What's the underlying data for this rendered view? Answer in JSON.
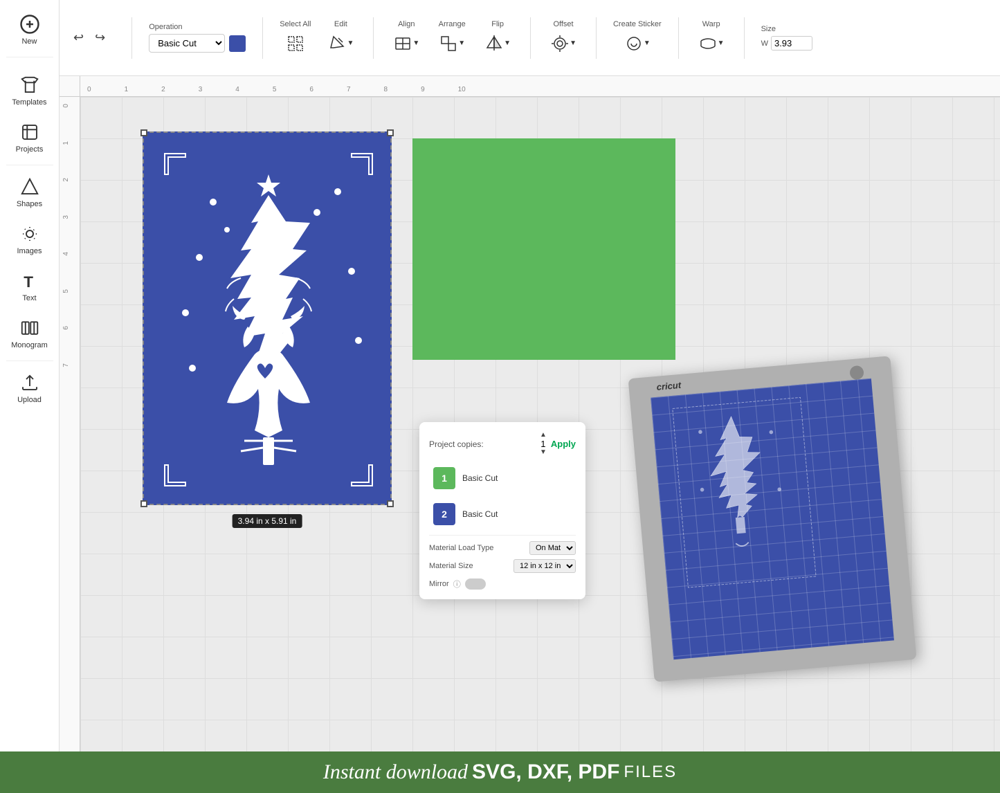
{
  "sidebar": {
    "items": [
      {
        "id": "new",
        "label": "New",
        "icon": "plus"
      },
      {
        "id": "templates",
        "label": "Templates",
        "icon": "tshirt"
      },
      {
        "id": "projects",
        "label": "Projects",
        "icon": "clipboard"
      },
      {
        "id": "shapes",
        "label": "Shapes",
        "icon": "triangle"
      },
      {
        "id": "images",
        "label": "Images",
        "icon": "image"
      },
      {
        "id": "text",
        "label": "Text",
        "icon": "T"
      },
      {
        "id": "monogram",
        "label": "Monogram",
        "icon": "monogram"
      },
      {
        "id": "upload",
        "label": "Upload",
        "icon": "upload"
      }
    ]
  },
  "toolbar": {
    "operation_label": "Operation",
    "operation_value": "Basic Cut",
    "select_all_label": "Select All",
    "edit_label": "Edit",
    "align_label": "Align",
    "arrange_label": "Arrange",
    "flip_label": "Flip",
    "offset_label": "Offset",
    "create_sticker_label": "Create Sticker",
    "warp_label": "Warp",
    "size_label": "Size",
    "size_w_label": "W",
    "size_w_value": "3.93"
  },
  "canvas": {
    "ruler_marks": [
      "0",
      "1",
      "2",
      "3",
      "4",
      "5",
      "6",
      "7",
      "8",
      "9",
      "10"
    ],
    "ruler_marks_v": [
      "0",
      "1",
      "2",
      "3",
      "4",
      "5",
      "6",
      "7"
    ]
  },
  "design": {
    "dimensions": "3.94 in x 5.91 in"
  },
  "cut_panel": {
    "project_copies_label": "Project copies:",
    "project_copies_value": "1",
    "apply_label": "Apply",
    "mat1_num": "1",
    "mat1_type": "Basic Cut",
    "mat2_num": "2",
    "mat2_type": "Basic Cut",
    "material_load_type_label": "Material Load Type",
    "material_load_value": "On Mat",
    "material_size_label": "Material Size",
    "material_size_value": "12 in x 12 in",
    "mirror_label": "Mirror"
  },
  "mat_preview": {
    "brand": "cricut"
  },
  "bottom_bar": {
    "text_script": "Instant download",
    "text_formats": "SVG, DXF, PDF",
    "text_files": "FILES"
  }
}
